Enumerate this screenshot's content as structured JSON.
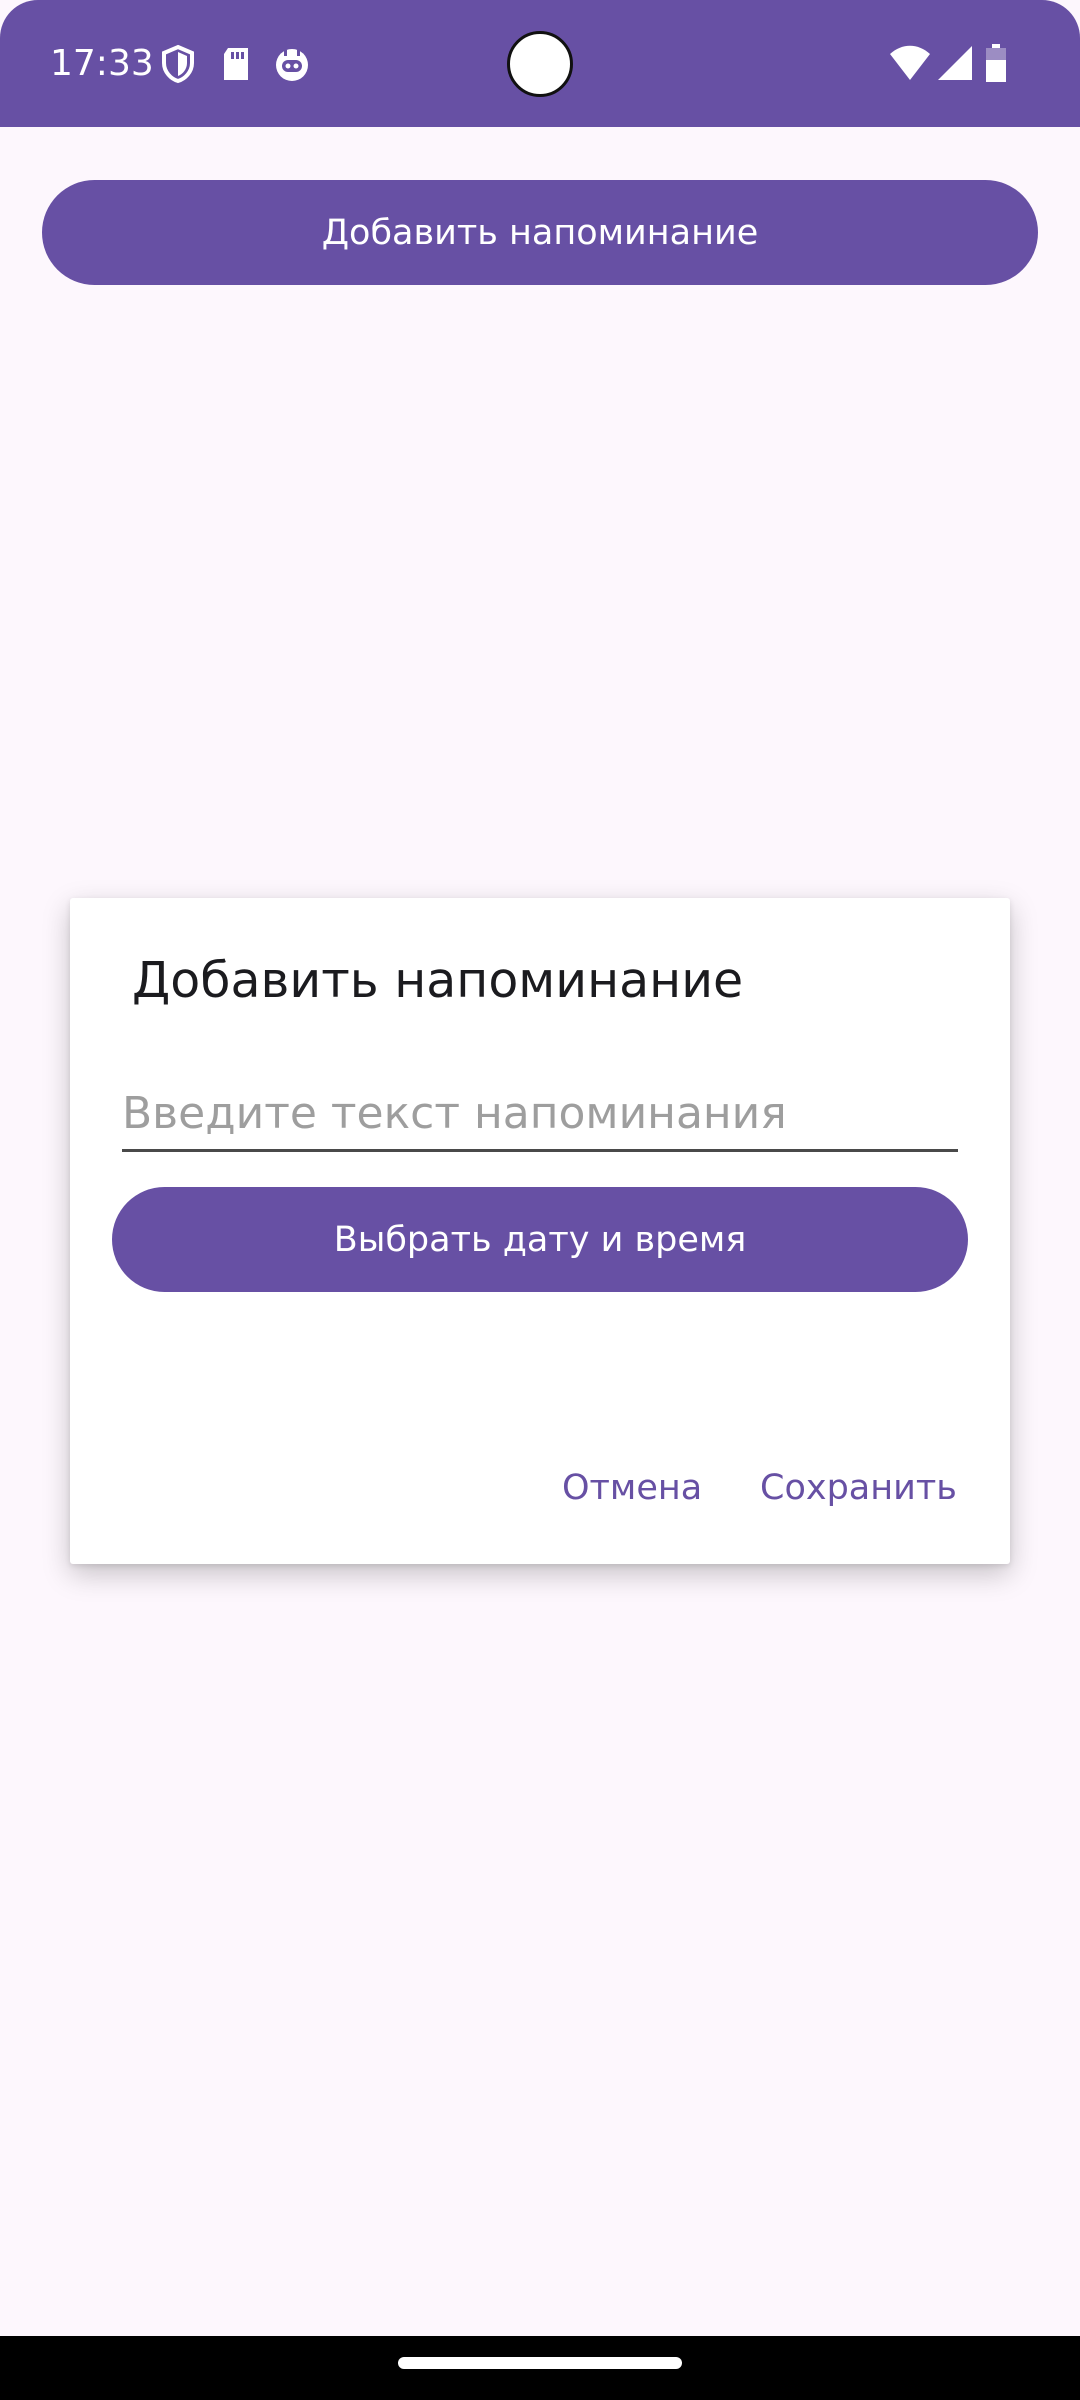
{
  "status_bar": {
    "time": "17:33",
    "icons_left": [
      "shield-icon",
      "sd-card-icon",
      "robot-icon"
    ],
    "icons_right": [
      "wifi-icon",
      "cellular-signal-icon",
      "battery-icon"
    ],
    "background_color": "#6750A4"
  },
  "main": {
    "add_button_label": "Добавить напоминание"
  },
  "dialog": {
    "title": "Добавить напоминание",
    "input_placeholder": "Введите текст напоминания",
    "input_value": "",
    "datetime_button_label": "Выбрать дату и время",
    "cancel_label": "Отмена",
    "save_label": "Сохранить"
  },
  "colors": {
    "accent": "#6750A4",
    "background": "#FDF7FD",
    "surface": "#FFFFFF"
  }
}
